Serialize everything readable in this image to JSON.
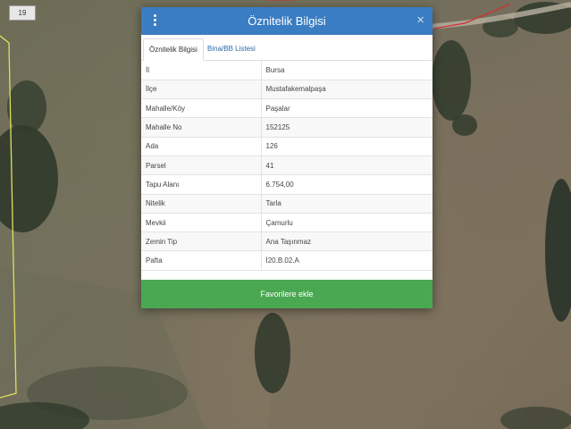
{
  "map": {
    "grid_label": "19",
    "watermark": "he"
  },
  "modal": {
    "title": "Öznitelik Bilgisi",
    "close_symbol": "×",
    "menu_icon": "kebab-menu-icon",
    "header_color": "#3a7dc2",
    "tabs": [
      {
        "label": "Öznitelik Bilgisi",
        "active": true
      },
      {
        "label": "Bina/BB Listesi",
        "active": false
      }
    ],
    "rows": [
      {
        "key": "İl",
        "value": "Bursa"
      },
      {
        "key": "İlçe",
        "value": "Mustafakemalpaşa"
      },
      {
        "key": "Mahalle/Köy",
        "value": "Paşalar"
      },
      {
        "key": "Mahalle No",
        "value": "152125"
      },
      {
        "key": "Ada",
        "value": "126"
      },
      {
        "key": "Parsel",
        "value": "41"
      },
      {
        "key": "Tapu Alanı",
        "value": "6.754,00"
      },
      {
        "key": "Nitelik",
        "value": "Tarla"
      },
      {
        "key": "Mevkii",
        "value": "Çamurlu"
      },
      {
        "key": "Zemin Tip",
        "value": "Ana Taşınmaz"
      },
      {
        "key": "Pafta",
        "value": "İ20.B.02.A"
      }
    ],
    "favorite_button": "Favorilere ekle",
    "favorite_color": "#4aa852"
  }
}
